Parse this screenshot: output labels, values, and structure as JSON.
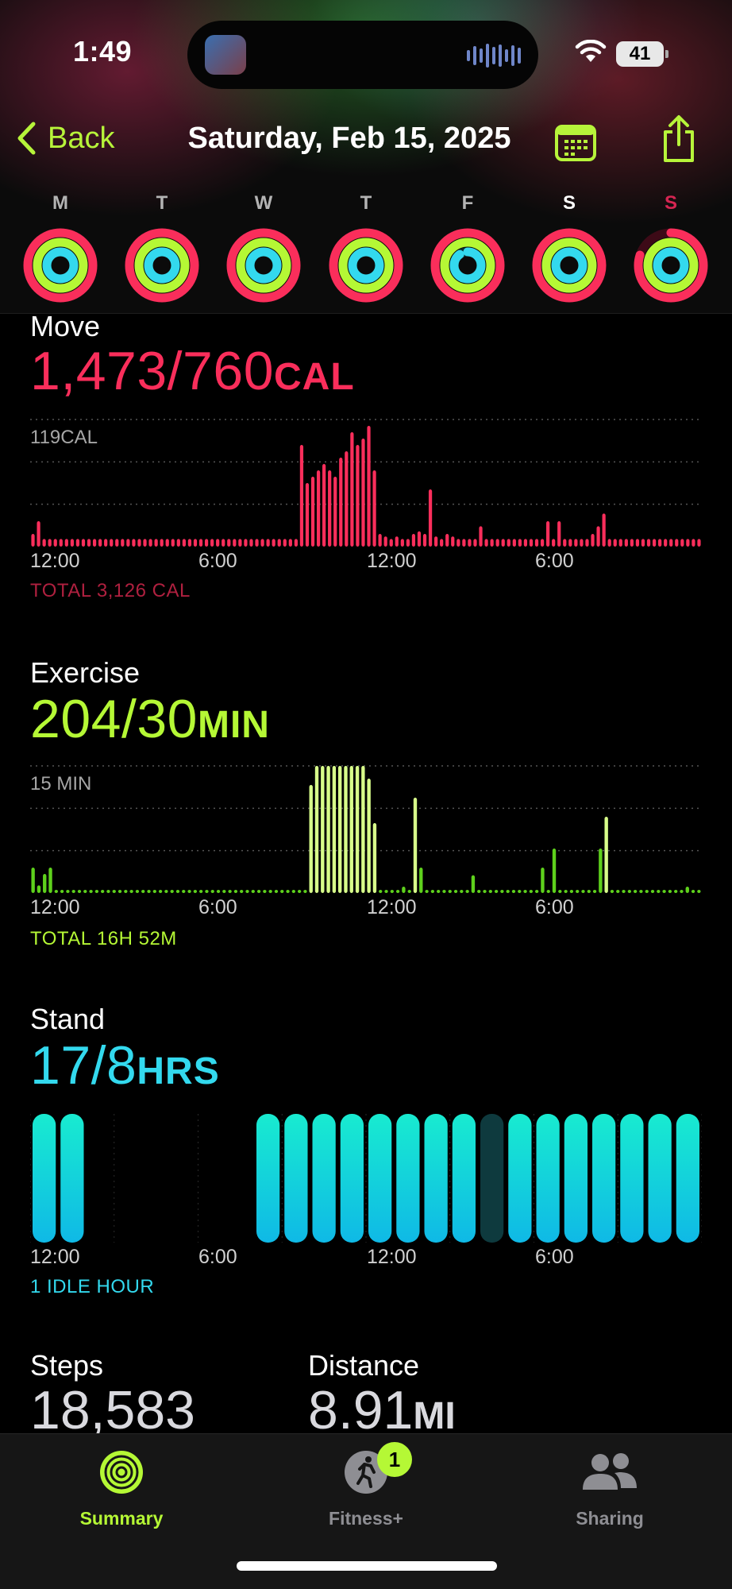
{
  "status": {
    "time": "1:49",
    "battery": "41"
  },
  "nav": {
    "back_label": "Back",
    "title": "Saturday, Feb 15, 2025"
  },
  "week": {
    "days": [
      "M",
      "T",
      "W",
      "T",
      "F",
      "S",
      "S"
    ],
    "selected_index": 5,
    "rings": [
      {
        "move": 1.0,
        "exercise": 1.0,
        "stand": 1.0
      },
      {
        "move": 1.0,
        "exercise": 1.0,
        "stand": 1.0
      },
      {
        "move": 1.0,
        "exercise": 1.0,
        "stand": 1.0
      },
      {
        "move": 1.0,
        "exercise": 1.0,
        "stand": 1.0
      },
      {
        "move": 1.0,
        "exercise": 1.0,
        "stand": 0.9
      },
      {
        "move": 1.0,
        "exercise": 1.0,
        "stand": 1.0
      },
      {
        "move": 0.8,
        "exercise": 1.0,
        "stand": 1.0
      }
    ]
  },
  "move": {
    "title": "Move",
    "value": "1,473/760",
    "unit": "CAL",
    "scale_label": "119CAL",
    "total": "TOTAL 3,126 CAL",
    "x_ticks": [
      "12:00",
      "6:00",
      "12:00",
      "6:00"
    ]
  },
  "exercise": {
    "title": "Exercise",
    "value": "204/30",
    "unit": "MIN",
    "scale_label": "15 MIN",
    "total": "TOTAL 16H 52M",
    "x_ticks": [
      "12:00",
      "6:00",
      "12:00",
      "6:00"
    ]
  },
  "stand": {
    "title": "Stand",
    "value": "17/8",
    "unit": "HRS",
    "footnote": "1 IDLE HOUR",
    "x_ticks": [
      "12:00",
      "6:00",
      "12:00",
      "6:00"
    ]
  },
  "steps": {
    "title": "Steps",
    "value": "18,583"
  },
  "distance": {
    "title": "Distance",
    "value": "8.91",
    "unit": "MI"
  },
  "tabs": [
    {
      "label": "Summary",
      "active": true
    },
    {
      "label": "Fitness+",
      "badge": "1"
    },
    {
      "label": "Sharing"
    }
  ],
  "colors": {
    "move": "#fa2e5b",
    "exercise": "#b5f835",
    "stand": "#33d9ee",
    "exercise_light": "#d8ff8a",
    "accent": "#b7f43a"
  },
  "chart_data": [
    {
      "type": "bar",
      "title": "Move",
      "ylabel": "119CAL",
      "x_ticks": [
        "12:00",
        "6:00",
        "12:00",
        "6:00"
      ],
      "values": [
        0.1,
        0.2,
        0.06,
        0.06,
        0.06,
        0.06,
        0.06,
        0.06,
        0.06,
        0.06,
        0.06,
        0.06,
        0.06,
        0.06,
        0.06,
        0.06,
        0.06,
        0.06,
        0.06,
        0.06,
        0.06,
        0.06,
        0.06,
        0.06,
        0.06,
        0.06,
        0.06,
        0.06,
        0.06,
        0.06,
        0.06,
        0.06,
        0.06,
        0.06,
        0.06,
        0.06,
        0.06,
        0.06,
        0.06,
        0.06,
        0.06,
        0.06,
        0.06,
        0.06,
        0.06,
        0.06,
        0.06,
        0.06,
        0.8,
        0.5,
        0.55,
        0.6,
        0.65,
        0.6,
        0.55,
        0.7,
        0.75,
        0.9,
        0.8,
        0.85,
        0.95,
        0.6,
        0.1,
        0.08,
        0.06,
        0.08,
        0.06,
        0.06,
        0.1,
        0.12,
        0.1,
        0.45,
        0.08,
        0.06,
        0.1,
        0.08,
        0.06,
        0.06,
        0.06,
        0.06,
        0.16,
        0.06,
        0.06,
        0.06,
        0.06,
        0.06,
        0.06,
        0.06,
        0.06,
        0.06,
        0.06,
        0.06,
        0.2,
        0.06,
        0.2,
        0.06,
        0.06,
        0.06,
        0.06,
        0.06,
        0.1,
        0.16,
        0.26,
        0.06,
        0.06,
        0.06,
        0.06,
        0.06,
        0.06,
        0.06,
        0.06,
        0.06,
        0.06,
        0.06,
        0.06,
        0.06,
        0.06,
        0.06,
        0.06,
        0.06
      ]
    },
    {
      "type": "bar",
      "title": "Exercise",
      "ylabel": "15 MIN",
      "x_ticks": [
        "12:00",
        "6:00",
        "12:00",
        "6:00"
      ],
      "values": [
        0.2,
        0.06,
        0.15,
        0.2,
        0.02,
        0.02,
        0.02,
        0.02,
        0.02,
        0.02,
        0.02,
        0.02,
        0.02,
        0.02,
        0.02,
        0.02,
        0.02,
        0.02,
        0.02,
        0.02,
        0.02,
        0.02,
        0.02,
        0.02,
        0.02,
        0.02,
        0.02,
        0.02,
        0.02,
        0.02,
        0.02,
        0.02,
        0.02,
        0.02,
        0.02,
        0.02,
        0.02,
        0.02,
        0.02,
        0.02,
        0.02,
        0.02,
        0.02,
        0.02,
        0.02,
        0.02,
        0.02,
        0.02,
        0.85,
        1.0,
        1.0,
        1.0,
        1.0,
        1.0,
        1.0,
        1.0,
        1.0,
        1.0,
        0.9,
        0.55,
        0.02,
        0.02,
        0.02,
        0.02,
        0.05,
        0.02,
        0.75,
        0.2,
        0.02,
        0.02,
        0.02,
        0.02,
        0.02,
        0.02,
        0.02,
        0.02,
        0.14,
        0.02,
        0.02,
        0.02,
        0.02,
        0.02,
        0.02,
        0.02,
        0.02,
        0.02,
        0.02,
        0.02,
        0.2,
        0.02,
        0.35,
        0.02,
        0.02,
        0.02,
        0.02,
        0.02,
        0.02,
        0.02,
        0.35,
        0.6,
        0.02,
        0.02,
        0.02,
        0.02,
        0.02,
        0.02,
        0.02,
        0.02,
        0.02,
        0.02,
        0.02,
        0.02,
        0.02,
        0.05,
        0.02,
        0.02
      ]
    },
    {
      "type": "bar",
      "title": "Stand",
      "x_ticks": [
        "12:00",
        "6:00",
        "12:00",
        "6:00"
      ],
      "values": [
        1,
        1,
        0,
        0,
        0,
        0,
        0,
        0,
        1,
        1,
        1,
        1,
        1,
        1,
        1,
        1,
        0,
        1,
        1,
        1,
        1,
        1,
        1,
        1
      ],
      "idle_indices": [
        16
      ]
    }
  ]
}
